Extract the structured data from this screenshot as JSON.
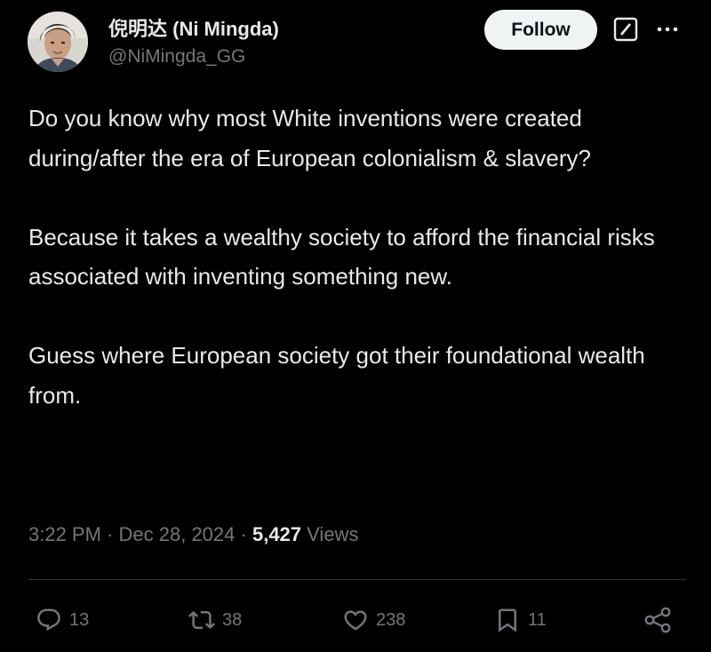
{
  "author": {
    "display_name": "倪明达 (Ni Mingda)",
    "handle": "@NiMingda_GG",
    "avatar_icon": "profile-photo"
  },
  "header": {
    "follow_label": "Follow",
    "grok_icon": "grok-icon",
    "more_icon": "more-icon"
  },
  "tweet": {
    "paragraphs": [
      "Do you know why most White inventions were created during/after the era of European colonialism & slavery?",
      "Because it takes a wealthy society to afford the financial risks associated with inventing something new.",
      "Guess where European society got their foundational wealth from."
    ]
  },
  "meta": {
    "time": "3:22 PM",
    "date": "Dec 28, 2024",
    "separator": "·",
    "views_count": "5,427",
    "views_label": "Views"
  },
  "actions": {
    "replies": "13",
    "reposts": "38",
    "likes": "238",
    "bookmarks": "11"
  },
  "colors": {
    "background": "#000000",
    "text_primary": "#e7e9ea",
    "text_secondary": "#71767b",
    "button_bg": "#eff3f4",
    "divider": "#2f3336"
  }
}
